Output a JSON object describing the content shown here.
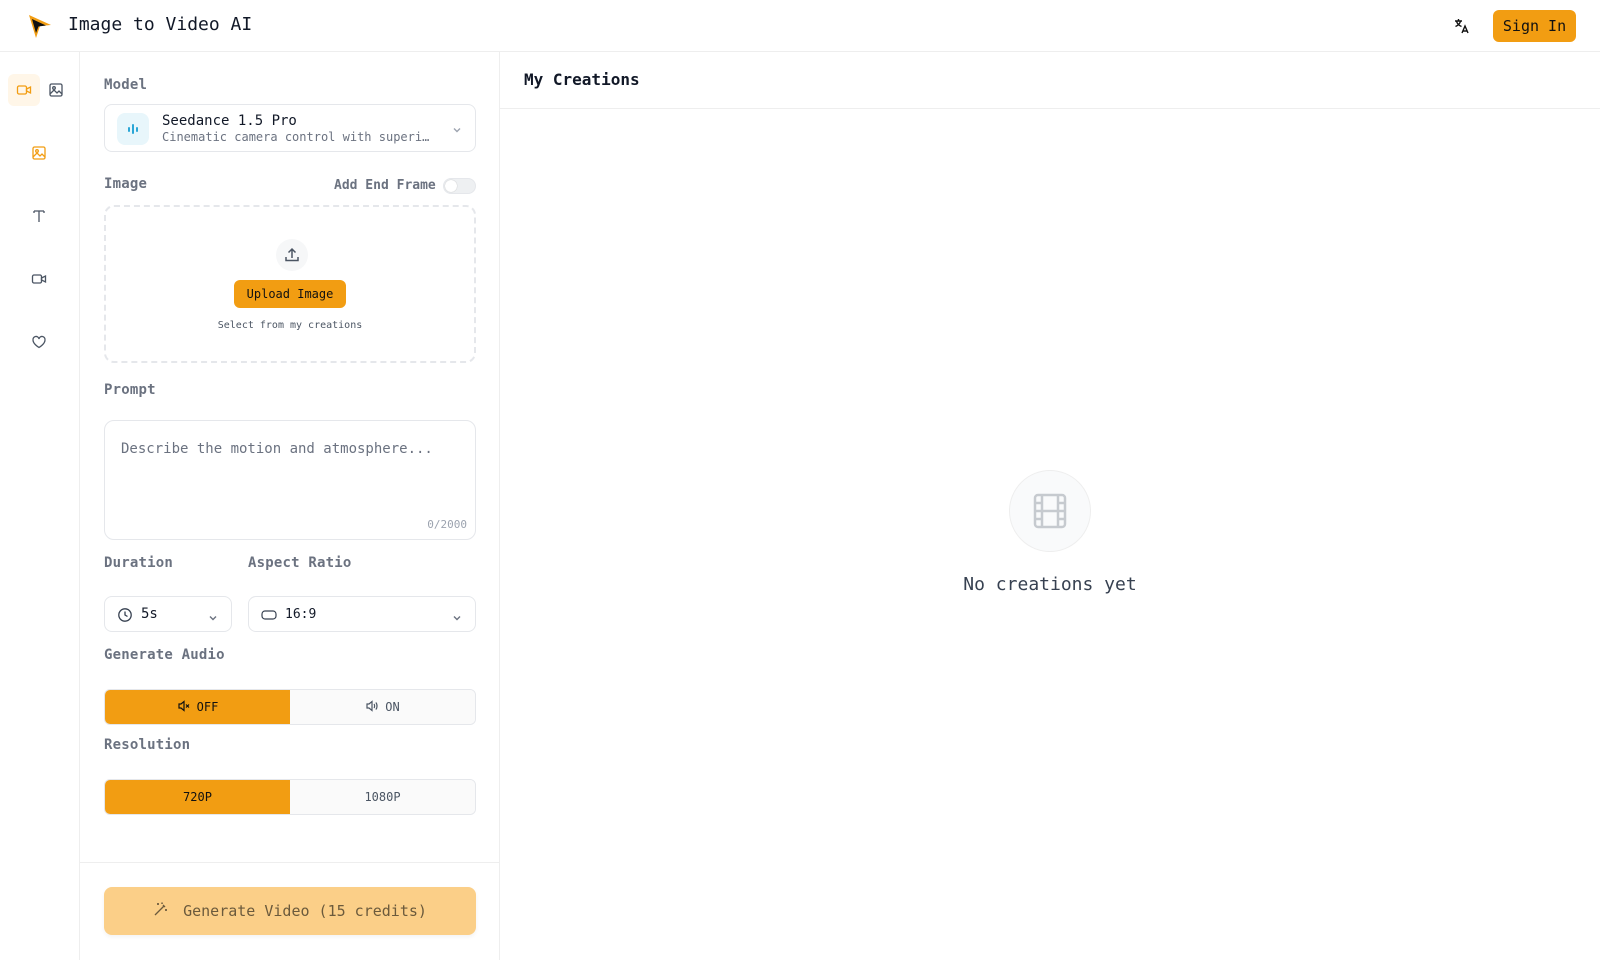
{
  "app": {
    "title": "Image to Video AI",
    "sign_in_label": "Sign In"
  },
  "colors": {
    "accent": "#f29d12",
    "accent_disabled": "#fbcf88",
    "border": "#e5e7eb"
  },
  "rail": {
    "items": [
      {
        "icon": "video-camera-icon",
        "active": true
      },
      {
        "icon": "image-icon"
      },
      {
        "icon": "image-icon",
        "highlight": true
      },
      {
        "icon": "text-icon"
      },
      {
        "icon": "video-camera-icon"
      },
      {
        "icon": "heart-icon"
      }
    ]
  },
  "form": {
    "model_label": "Model",
    "model": {
      "name": "Seedance 1.5 Pro",
      "description": "Cinematic camera control with superior motion"
    },
    "image_label": "Image",
    "end_frame_label": "Add End Frame",
    "end_frame_enabled": false,
    "upload_button": "Upload Image",
    "upload_sub": "Select from my creations",
    "prompt_label": "Prompt",
    "prompt_placeholder": "Describe the motion and atmosphere...",
    "prompt_counter": "0/2000",
    "duration_label": "Duration",
    "duration_value": "5s",
    "aspect_label": "Aspect Ratio",
    "aspect_value": "16:9",
    "audio_label": "Generate Audio",
    "audio_off": "OFF",
    "audio_on": "ON",
    "resolution_label": "Resolution",
    "res_720": "720P",
    "res_1080": "1080P",
    "generate_button": "Generate Video (15 credits)"
  },
  "creations": {
    "title": "My Creations",
    "empty_text": "No creations yet"
  }
}
